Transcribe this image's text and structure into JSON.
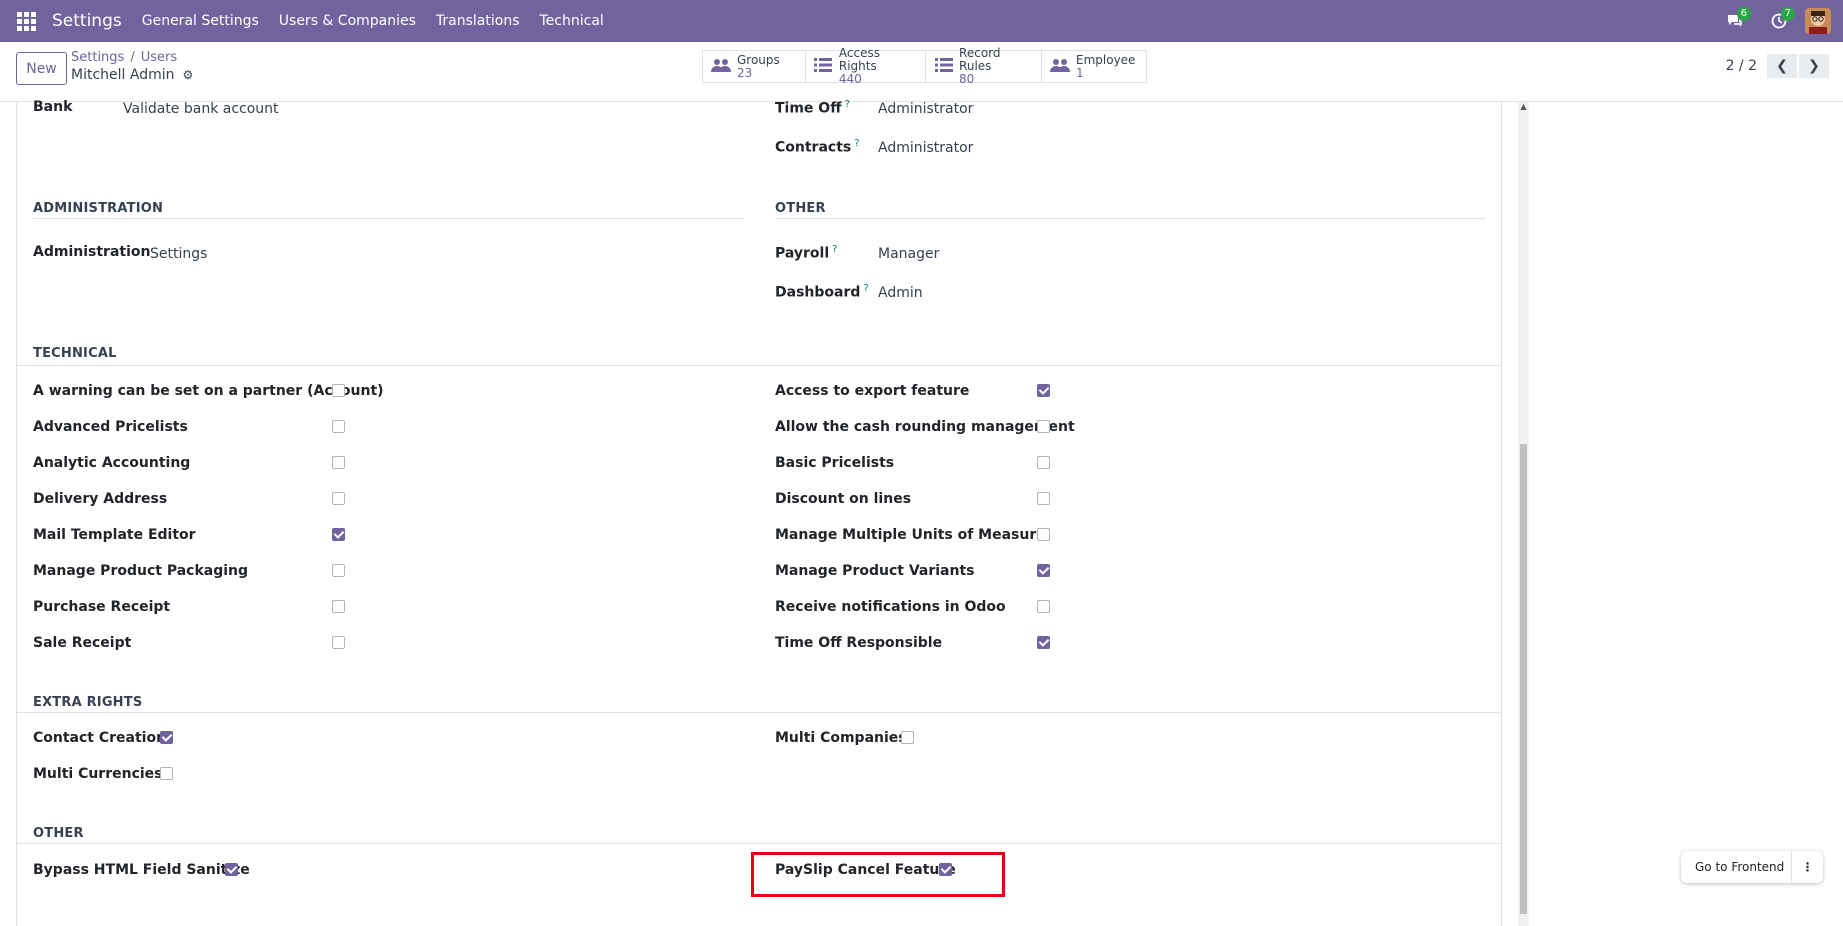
{
  "navbar": {
    "brand": "Settings",
    "menu": [
      "General Settings",
      "Users & Companies",
      "Translations",
      "Technical"
    ],
    "messages_count": "6",
    "activities_count": "7"
  },
  "control": {
    "new_label": "New",
    "breadcrumb": [
      "Settings",
      "Users"
    ],
    "record_name": "Mitchell Admin",
    "smart_buttons": [
      {
        "label": "Groups",
        "value": "23",
        "icon": "users-icon"
      },
      {
        "label": "Access Rights",
        "value": "440",
        "icon": "list-icon"
      },
      {
        "label": "Record Rules",
        "value": "80",
        "icon": "list-icon"
      },
      {
        "label": "Employee",
        "value": "1",
        "icon": "users-icon"
      }
    ],
    "pager": "2 / 2"
  },
  "top_fields": {
    "bank_label": "Bank",
    "bank_value": "Validate bank account",
    "timeoff_label": "Time Off",
    "timeoff_value": "Administrator",
    "contracts_label": "Contracts",
    "contracts_value": "Administrator",
    "help_mark": "?"
  },
  "administration": {
    "title": "ADMINISTRATION",
    "label": "Administration",
    "value": "Settings"
  },
  "other_top": {
    "title": "OTHER",
    "payroll_label": "Payroll",
    "payroll_value": "Manager",
    "dashboard_label": "Dashboard",
    "dashboard_value": "Admin"
  },
  "technical": {
    "title": "TECHNICAL",
    "left": [
      {
        "label": "A warning can be set on a partner (Account)",
        "checked": false
      },
      {
        "label": "Advanced Pricelists",
        "checked": false
      },
      {
        "label": "Analytic Accounting",
        "checked": false
      },
      {
        "label": "Delivery Address",
        "checked": false
      },
      {
        "label": "Mail Template Editor",
        "checked": true
      },
      {
        "label": "Manage Product Packaging",
        "checked": false
      },
      {
        "label": "Purchase Receipt",
        "checked": false
      },
      {
        "label": "Sale Receipt",
        "checked": false
      }
    ],
    "right": [
      {
        "label": "Access to export feature",
        "checked": true
      },
      {
        "label": "Allow the cash rounding management",
        "checked": false
      },
      {
        "label": "Basic Pricelists",
        "checked": false
      },
      {
        "label": "Discount on lines",
        "checked": false
      },
      {
        "label": "Manage Multiple Units of Measure",
        "checked": false
      },
      {
        "label": "Manage Product Variants",
        "checked": true
      },
      {
        "label": "Receive notifications in Odoo",
        "checked": false
      },
      {
        "label": "Time Off Responsible",
        "checked": true
      }
    ]
  },
  "extra_rights": {
    "title": "EXTRA RIGHTS",
    "contact_creation": "Contact Creation",
    "multi_currencies": "Multi Currencies",
    "multi_companies": "Multi Companies"
  },
  "other_bottom": {
    "title": "OTHER",
    "bypass": "Bypass HTML Field Sanitize",
    "payslip": "PaySlip Cancel Feature"
  },
  "frontend_label": "Go to Frontend",
  "colors": {
    "brand": "#71639e",
    "highlight": "#e6001a",
    "check": "#71639e"
  }
}
